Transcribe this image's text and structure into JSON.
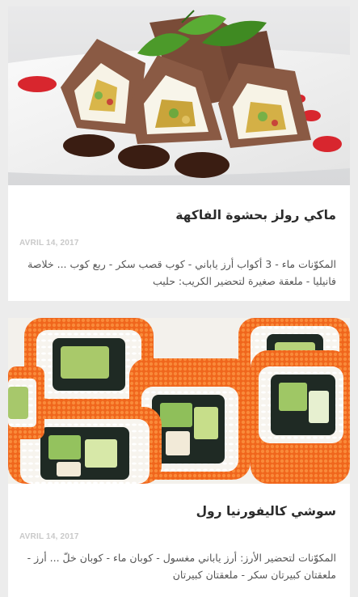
{
  "posts": [
    {
      "image_subject": "maki-rolls-fruit-filling",
      "title": "ماكي رولز بحشوة الفاكهة",
      "date": "AVRIL 14, 2017",
      "excerpt": "المكوّنات ماء - 3 أكواب أرز ياباني - كوب قصب سكر - ربع كوب ... خلاصة فانيليا - ملعقة صغيرة لتحضير الكريب: حليب"
    },
    {
      "image_subject": "california-sushi-roll",
      "title": "سوشي كاليفورنيا رول",
      "date": "AVRIL 14, 2017",
      "excerpt": "المكوّنات لتحضير الأرز: أرز ياباني مغسول - كوبان ماء - كوبان خلّ ... أرز - ملعقتان كبيرتان سكر - ملعقتان كبيرتان"
    }
  ],
  "colors": {
    "page_background": "#ececec",
    "card_background": "#ffffff",
    "title_text": "#2b2b2b",
    "date_text": "#c9c9c9",
    "excerpt_text": "#555555",
    "roe_orange": "#f0661c",
    "crepe_brown": "#8a5a44"
  }
}
